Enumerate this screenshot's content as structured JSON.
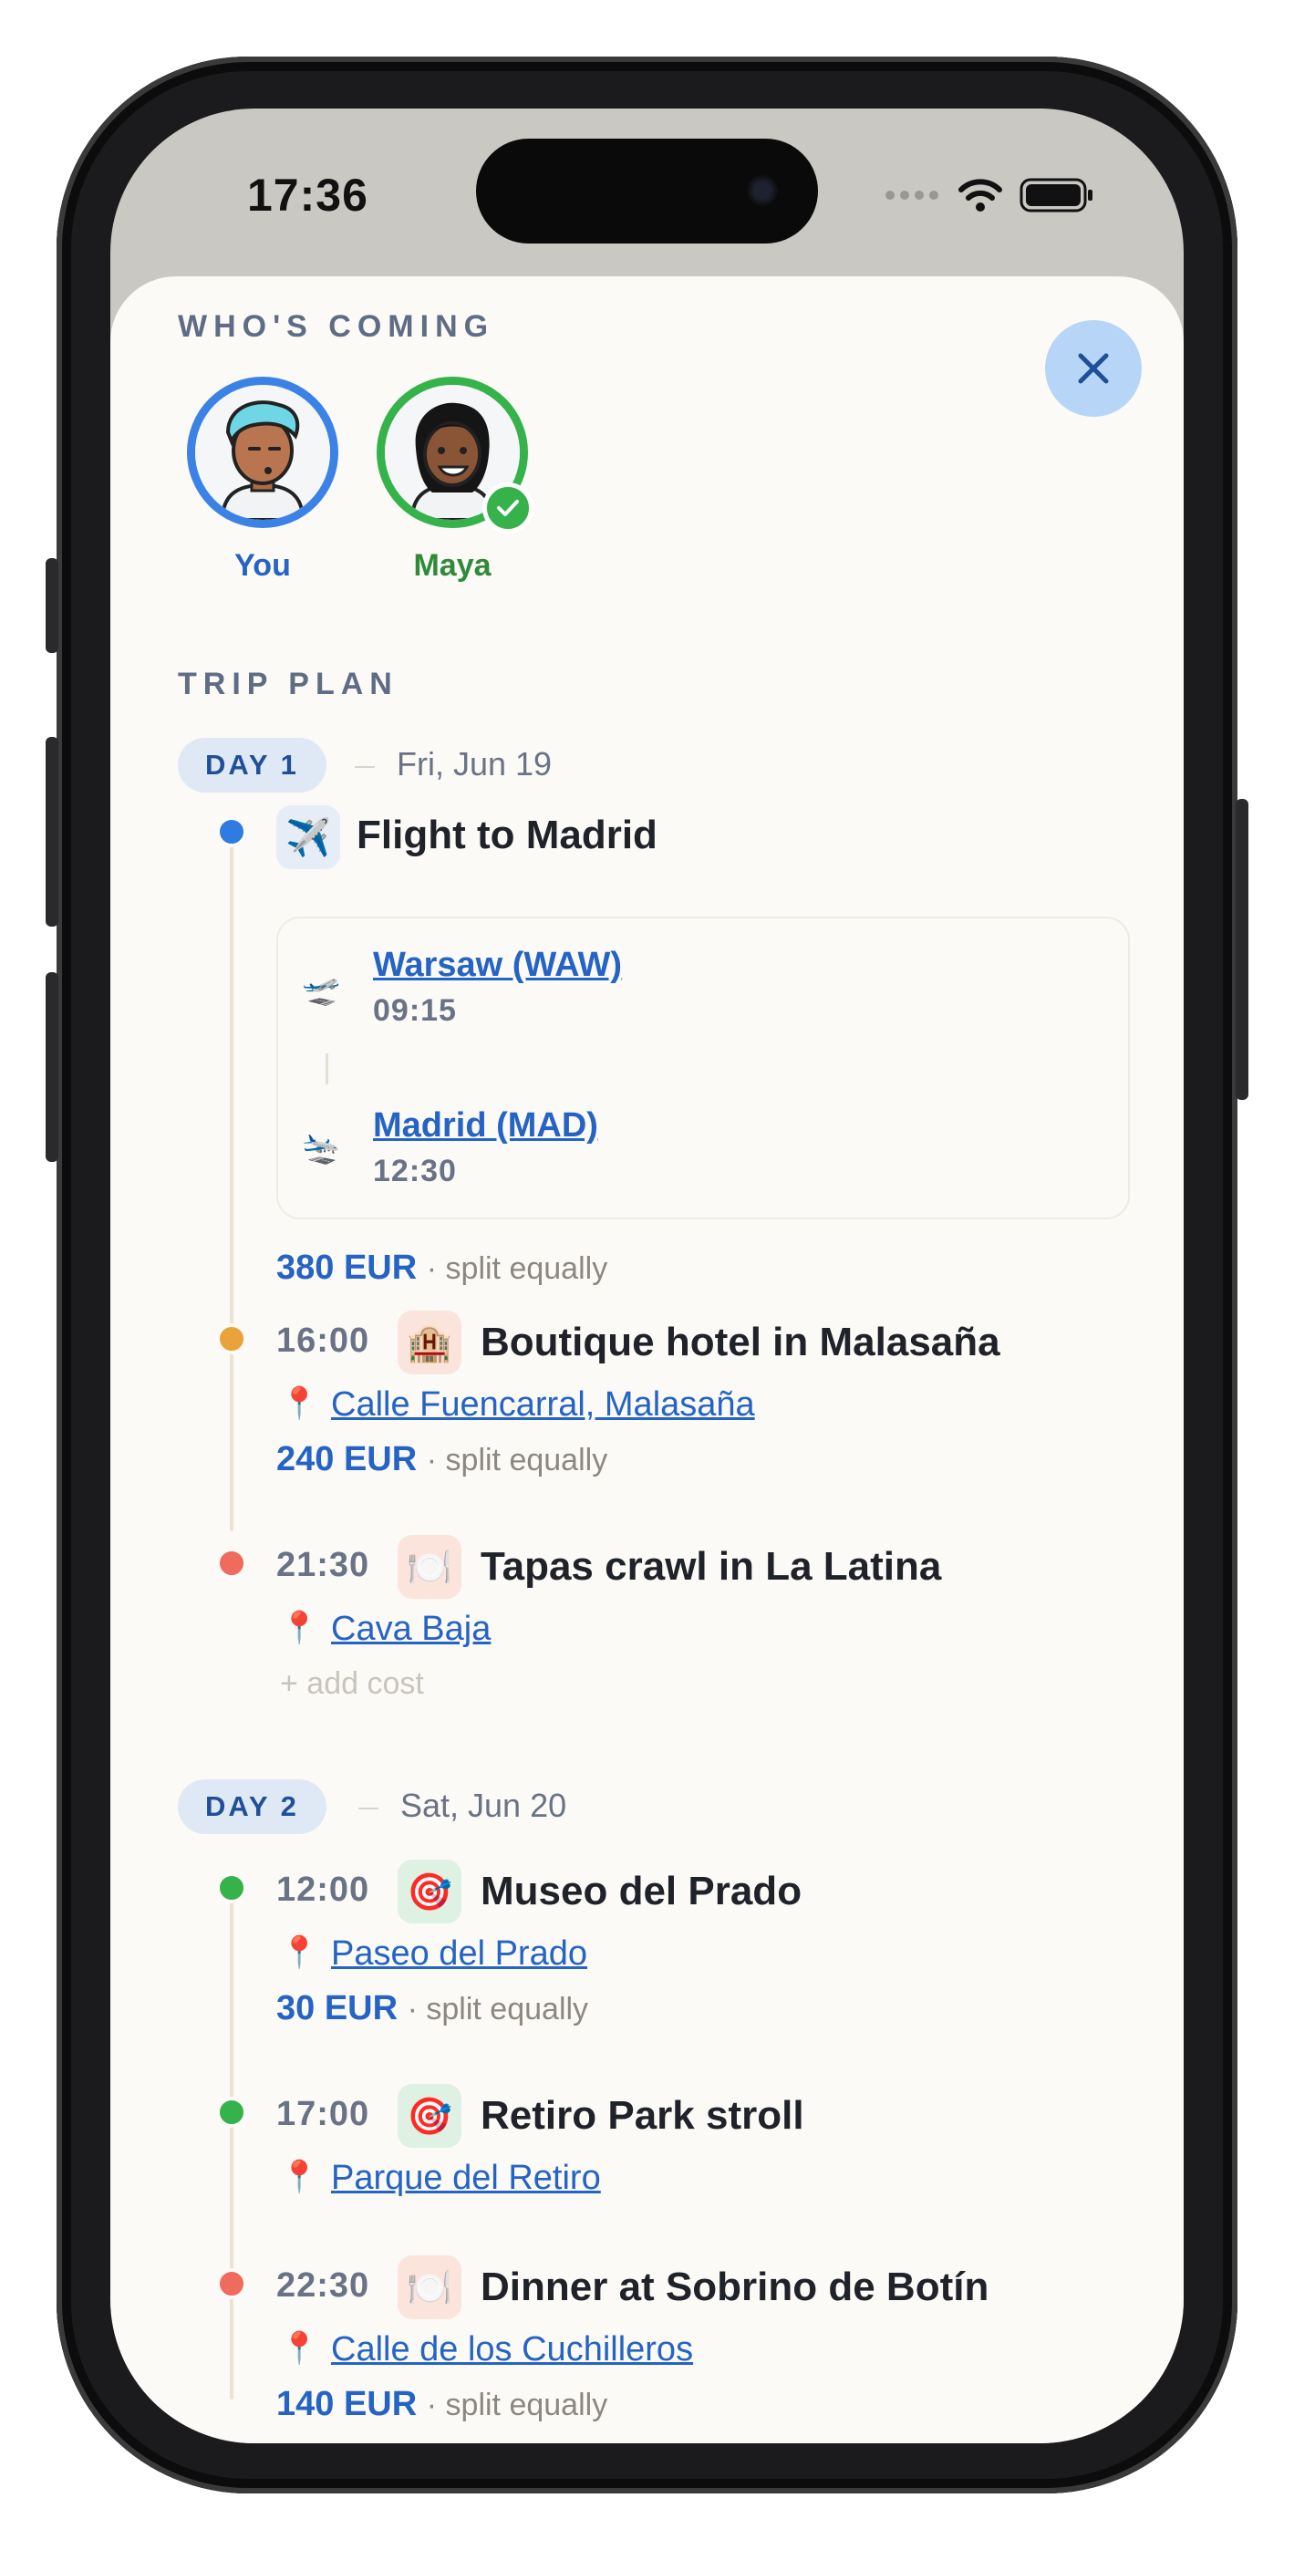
{
  "status_bar": {
    "time": "17:36"
  },
  "whos_coming": {
    "label": "WHO'S COMING",
    "people": [
      {
        "name": "You",
        "ring_color": "#3b82e6",
        "name_color": "#2563c4"
      },
      {
        "name": "Maya",
        "ring_color": "#35b24a",
        "name_color": "#2f8a3a",
        "confirmed": true
      }
    ]
  },
  "trip_plan": {
    "label": "TRIP PLAN",
    "days": [
      {
        "pill": "DAY 1",
        "date": "Fri, Jun 19",
        "events": [
          {
            "icon": "airplane-icon",
            "title": "Flight to Madrid",
            "dot_color": "#2f7be0",
            "flight": {
              "departure": {
                "place": "Warsaw (WAW)",
                "time": "09:15"
              },
              "arrival": {
                "place": "Madrid (MAD)",
                "time": "12:30"
              }
            },
            "cost": {
              "amount": "380 EUR",
              "note": "· split equally"
            }
          },
          {
            "time": "16:00",
            "icon": "hotel-icon",
            "title": "Boutique hotel in Malasaña",
            "dot_color": "#eaa23a",
            "location": "Calle Fuencarral, Malasaña",
            "cost": {
              "amount": "240 EUR",
              "note": "· split equally"
            }
          },
          {
            "time": "21:30",
            "icon": "plate-icon",
            "title": "Tapas crawl in La Latina",
            "dot_color": "#ef6b5c",
            "location": "Cava Baja",
            "add_cost": "+ add cost"
          }
        ]
      },
      {
        "pill": "DAY 2",
        "date": "Sat, Jun 20",
        "events": [
          {
            "time": "12:00",
            "icon": "target-icon",
            "title": "Museo del Prado",
            "dot_color": "#35b24a",
            "location": "Paseo del Prado",
            "cost": {
              "amount": "30 EUR",
              "note": "· split equally"
            }
          },
          {
            "time": "17:00",
            "icon": "target-icon",
            "title": "Retiro Park stroll",
            "dot_color": "#35b24a",
            "location": "Parque del Retiro"
          },
          {
            "time": "22:30",
            "icon": "plate-icon",
            "title": "Dinner at Sobrino de Botín",
            "dot_color": "#ef6b5c",
            "location": "Calle de los Cuchilleros",
            "cost": {
              "amount": "140 EUR",
              "note": "· split equally"
            }
          }
        ]
      }
    ]
  },
  "colors": {
    "accent_blue": "#2563c4",
    "sheet_bg": "#fbfaf6",
    "close_bg": "#b7d6f7"
  }
}
